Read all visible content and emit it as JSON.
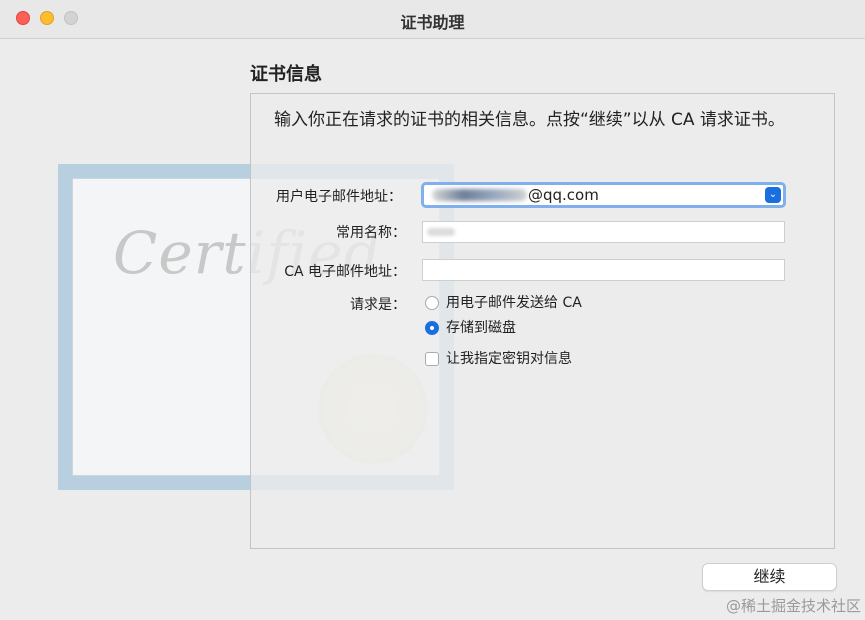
{
  "window": {
    "title": "证书助理"
  },
  "certificate_art": {
    "script_text": "Certified"
  },
  "section": {
    "title": "证书信息",
    "intro": "输入你正在请求的证书的相关信息。点按“继续”以从 CA 请求证书。"
  },
  "form": {
    "email_label": "用户电子邮件地址：",
    "email_value_suffix": "@qq.com",
    "common_name_label": "常用名称：",
    "ca_email_label": "CA 电子邮件地址：",
    "ca_email_value": "",
    "request_label": "请求是：",
    "option_email_to_ca": "用电子邮件发送给 CA",
    "option_save_to_disk": "存储到磁盘",
    "option_specify_key": "让我指定密钥对信息",
    "selected_option": "存储到磁盘",
    "specify_key_checked": false
  },
  "buttons": {
    "continue_label": "继续"
  },
  "watermark": {
    "text": "@稀土掘金技术社区"
  },
  "colors": {
    "accent": "#1a6fe0",
    "focus_ring": "#7fb0ed",
    "close": "#fe5f57",
    "minimize": "#febc2e",
    "zoom_disabled": "#d3d3d3"
  }
}
